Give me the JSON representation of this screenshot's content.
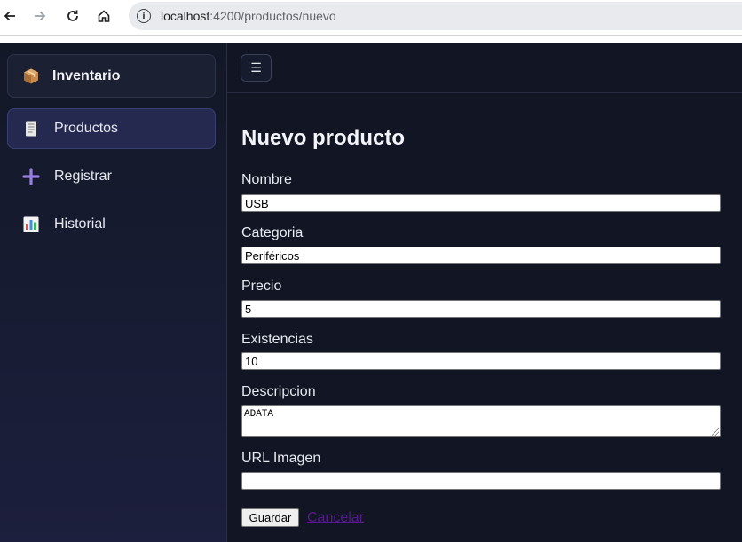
{
  "browser": {
    "url_host": "localhost",
    "url_path": ":4200/productos/nuevo"
  },
  "sidebar": {
    "brand": {
      "label": "Inventario",
      "icon": "package-icon"
    },
    "items": [
      {
        "label": "Productos",
        "icon": "document-icon",
        "active": true
      },
      {
        "label": "Registrar",
        "icon": "plus-icon",
        "active": false
      },
      {
        "label": "Historial",
        "icon": "bar-chart-icon",
        "active": false
      }
    ]
  },
  "topbar": {
    "menu_glyph": "☰"
  },
  "form": {
    "title": "Nuevo producto",
    "fields": [
      {
        "label": "Nombre",
        "value": "USB"
      },
      {
        "label": "Categoria",
        "value": "Periféricos"
      },
      {
        "label": "Precio",
        "value": "5"
      },
      {
        "label": "Existencias",
        "value": "10"
      },
      {
        "label": "Descripcion",
        "value": "ADATA"
      },
      {
        "label": "URL Imagen",
        "value": ""
      }
    ],
    "save_label": "Guardar",
    "cancel_label": "Cancelar"
  },
  "colors": {
    "sidebar_bg": "#131827",
    "main_bg": "#111524",
    "active_item_bg": "#25294f",
    "link_visited": "#551a8b"
  }
}
